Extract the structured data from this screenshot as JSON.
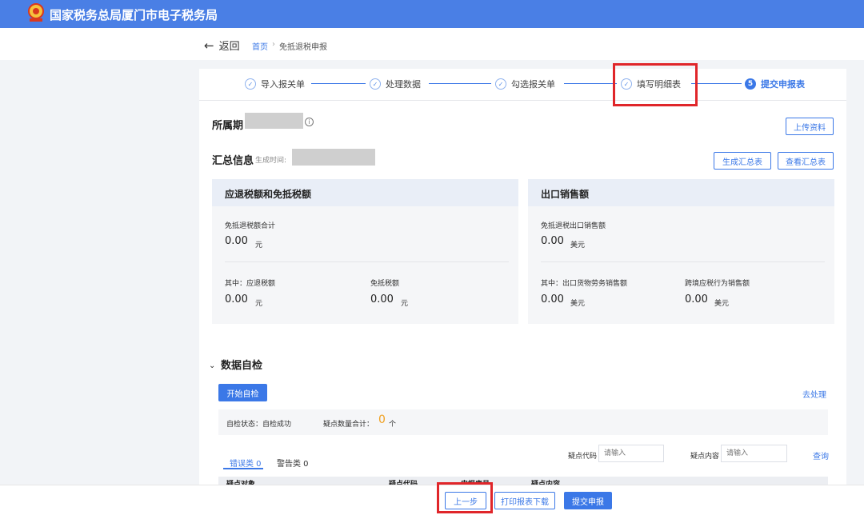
{
  "header": {
    "site_title": "国家税务总局厦门市电子税务局"
  },
  "nav": {
    "back_label": "返回",
    "breadcrumb": [
      "首页",
      "免抵退税申报"
    ],
    "breadcrumb_sep": "›"
  },
  "steps": [
    {
      "label": "导入报关单",
      "state": "done"
    },
    {
      "label": "处理数据",
      "state": "done"
    },
    {
      "label": "勾选报关单",
      "state": "done"
    },
    {
      "label": "填写明细表",
      "state": "done"
    },
    {
      "label": "提交申报表",
      "state": "current",
      "number": "5"
    }
  ],
  "period": {
    "label": "所属期",
    "info_icon": "i",
    "upload_button": "上传资料"
  },
  "summary": {
    "title": "汇总信息",
    "generated_time_label": "生成时间:",
    "buttons": {
      "generate": "生成汇总表",
      "view": "查看汇总表"
    },
    "left_panel": {
      "title": "应退税额和免抵税额",
      "total_label": "免抵退税额合计",
      "total_value": "0.00",
      "total_unit": "元",
      "refund_label": "其中：应退税额",
      "refund_value": "0.00",
      "refund_unit": "元",
      "exempt_label": "免抵税额",
      "exempt_value": "0.00",
      "exempt_unit": "元"
    },
    "right_panel": {
      "title": "出口销售额",
      "total_label": "免抵退税出口销售额",
      "total_value": "0.00",
      "total_unit": "美元",
      "goods_label": "其中：出口货物劳务销售额",
      "goods_value": "0.00",
      "goods_unit": "美元",
      "cross_label": "跨境应税行为销售额",
      "cross_value": "0.00",
      "cross_unit": "美元"
    }
  },
  "self_check": {
    "title": "数据自检",
    "start_button": "开始自检",
    "go_process_link": "去处理",
    "status_label": "自检状态：自检成功",
    "doubt_label": "疑点数量合计：",
    "doubt_count": "0",
    "doubt_unit": "个",
    "tabs": [
      "错误类 0",
      "警告类 0"
    ],
    "filter": {
      "code_label": "疑点代码",
      "code_placeholder": "请输入",
      "content_label": "疑点内容",
      "content_placeholder": "请输入",
      "query_button": "查询"
    },
    "table_headers": [
      "疑点对象",
      "疑点代码",
      "申报序号",
      "疑点内容"
    ]
  },
  "footer": {
    "prev_button": "上一步",
    "print_button": "打印报表下载",
    "submit_button": "提交申报"
  },
  "colors": {
    "primary": "#3b78e7",
    "header": "#4a7fe5",
    "highlight_box": "#e0262a",
    "count": "#f0a020"
  }
}
